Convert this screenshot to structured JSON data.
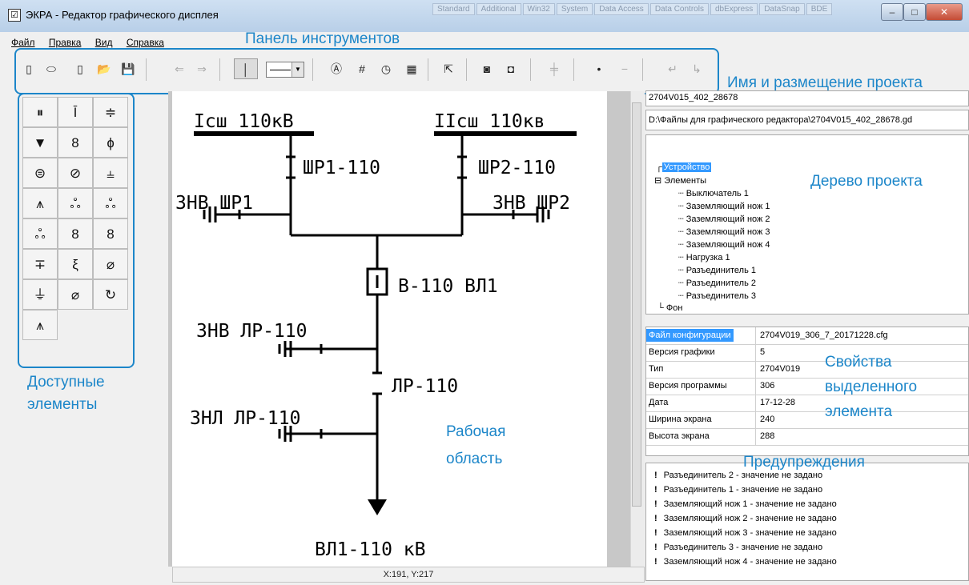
{
  "window": {
    "title": "ЭКРА - Редактор графического дисплея",
    "faint_tabs": [
      "Standard",
      "Additional",
      "Win32",
      "System",
      "Data Access",
      "Data Controls",
      "dbExpress",
      "DataSnap",
      "BDE"
    ],
    "buttons": {
      "minimize": "–",
      "maximize": "□",
      "close": "✕"
    }
  },
  "menu": [
    "Файл",
    "Правка",
    "Вид",
    "Справка"
  ],
  "toolbar_icons": [
    "new-rect-icon",
    "new-ellipse-icon",
    "new-rounded-icon",
    "open-folder-icon",
    "save-icon",
    "arrow-left-icon",
    "arrow-right-icon",
    "line-width-icon",
    "line-style-combo",
    "text-icon",
    "grid-icon",
    "clock-icon",
    "calculator-icon",
    "pointer-icon",
    "front-icon",
    "back-icon",
    "grid-lines-icon",
    "dot-icon",
    "minus-icon",
    "undo-icon",
    "redo-icon"
  ],
  "annotations": {
    "toolbar": "Панель инструментов",
    "project": "Имя и размещение проекта",
    "tree": "Дерево проекта",
    "palette_1": "Доступные",
    "palette_2": "элементы",
    "work_1": "Рабочая",
    "work_2": "область",
    "props_1": "Свойства",
    "props_2": "выделенного",
    "props_3": "элемента",
    "warnings": "Предупреждения"
  },
  "scheme": {
    "bus1": "Iсш 110кВ",
    "bus2": "IIсш 110кв",
    "shr1": "ШР1-110",
    "shr2": "ШР2-110",
    "znv_shr1": "ЗНВ ШР1",
    "znv_shr2": "ЗНВ ШР2",
    "breaker": "В-110 ВЛ1",
    "znv_lr": "ЗНВ ЛР-110",
    "lr": "ЛР-110",
    "znl_lr": "ЗНЛ ЛР-110",
    "line": "ВЛ1-110 кВ"
  },
  "status": "X:191, Y:217",
  "project": {
    "name": "2704V015_402_28678",
    "path": "D:\\Файлы для графического редактора\\2704V015_402_28678.gd"
  },
  "tree": {
    "root": "Устройство",
    "group": "Элементы",
    "items": [
      "Выключатель 1",
      "Заземляющий нож 1",
      "Заземляющий нож 2",
      "Заземляющий нож 3",
      "Заземляющий нож 4",
      "Нагрузка 1",
      "Разъединитель 1",
      "Разъединитель 2",
      "Разъединитель 3"
    ],
    "background": "Фон"
  },
  "properties": [
    {
      "key": "Файл конфигурации",
      "value": "2704V019_306_7_20171228.cfg"
    },
    {
      "key": "Версия графики",
      "value": "5"
    },
    {
      "key": "Тип",
      "value": "2704V019"
    },
    {
      "key": "Версия программы",
      "value": "306"
    },
    {
      "key": "Дата",
      "value": "17-12-28"
    },
    {
      "key": "Ширина экрана",
      "value": "240"
    },
    {
      "key": "Высота экрана",
      "value": "288"
    }
  ],
  "warnings": [
    "Разъединитель 2 - значение не задано",
    "Разъединитель 1 - значение не задано",
    "Заземляющий нож 1 - значение не задано",
    "Заземляющий нож 2 - значение не задано",
    "Заземляющий нож 3 - значение не задано",
    "Разъединитель 3 - значение не задано",
    "Заземляющий нож 4 - значение не задано"
  ],
  "colors": {
    "annotation": "#1c86c9",
    "selection": "#3399ff"
  }
}
